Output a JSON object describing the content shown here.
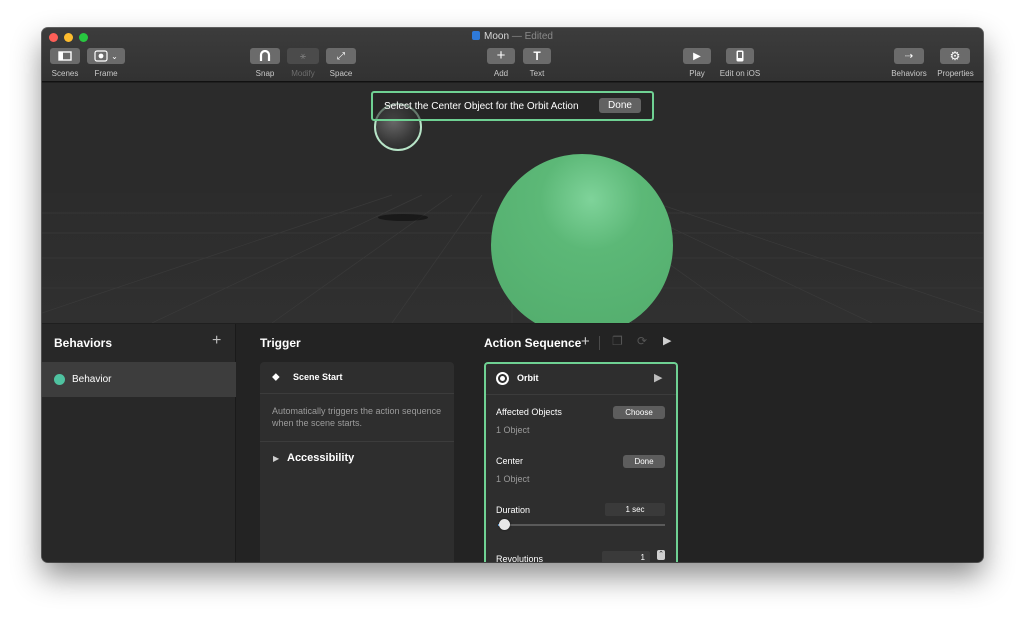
{
  "window": {
    "title": "Moon",
    "status": "— Edited"
  },
  "toolbar": {
    "scenes": "Scenes",
    "frame": "Frame",
    "snap": "Snap",
    "modify": "Modify",
    "space": "Space",
    "add": "Add",
    "text": "Text",
    "play": "Play",
    "edit_on_ios": "Edit on iOS",
    "behaviors": "Behaviors",
    "properties": "Properties"
  },
  "viewport": {
    "instruction": "Select the Center Object for the Orbit Action",
    "done_label": "Done"
  },
  "behaviors_panel": {
    "title": "Behaviors",
    "items": [
      {
        "label": "Behavior",
        "color": "#4fc2a0"
      }
    ]
  },
  "trigger_panel": {
    "title": "Trigger",
    "trigger_name": "Scene Start",
    "description": "Automatically triggers the action sequence when the scene starts.",
    "accessibility_label": "Accessibility"
  },
  "action_panel": {
    "title": "Action Sequence",
    "action_name": "Orbit",
    "affected_objects_label": "Affected Objects",
    "affected_objects_button": "Choose",
    "affected_objects_value": "1 Object",
    "center_label": "Center",
    "center_button": "Done",
    "center_value": "1 Object",
    "duration_label": "Duration",
    "duration_value": "1 sec",
    "duration_slider_fraction": 0.04,
    "revolutions_label": "Revolutions",
    "revolutions_value": "1"
  },
  "colors": {
    "accent": "#6fd193",
    "moon_highlight": "#5cb877"
  }
}
